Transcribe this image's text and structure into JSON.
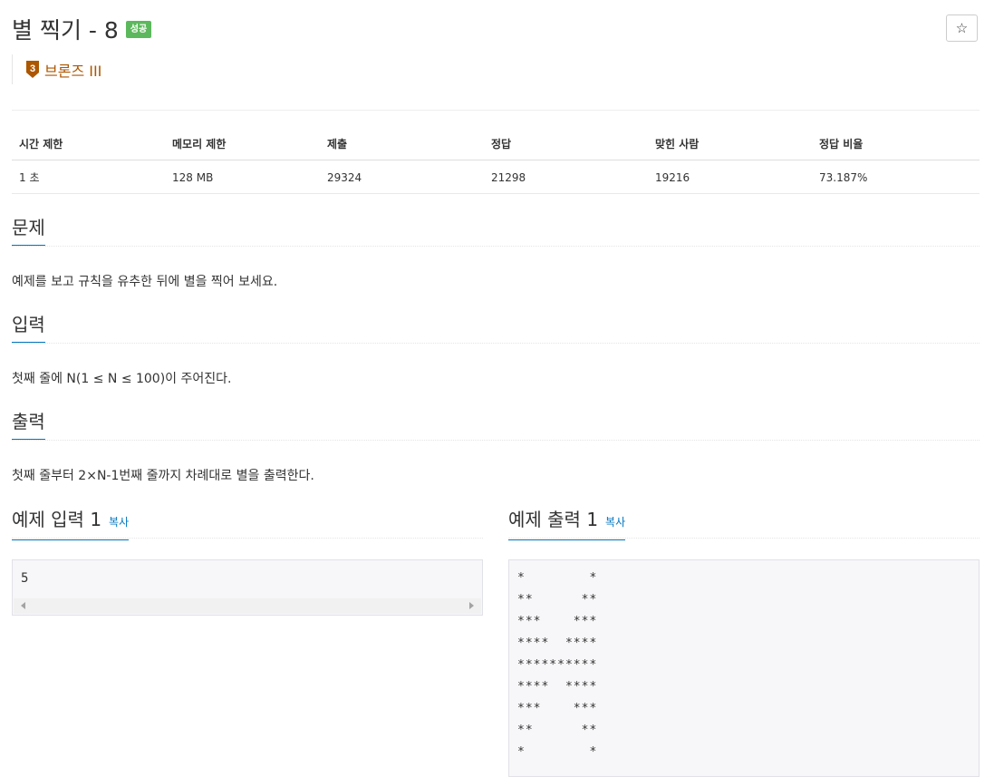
{
  "problem": {
    "title": "별 찍기 - 8",
    "status_badge": "성공",
    "tier": {
      "number": "3",
      "label": "브론즈 III",
      "color": "#ad5600"
    },
    "star_button_icon": "☆"
  },
  "info_table": {
    "headers": [
      "시간 제한",
      "메모리 제한",
      "제출",
      "정답",
      "맞힌 사람",
      "정답 비율"
    ],
    "values": [
      "1 초",
      "128 MB",
      "29324",
      "21298",
      "19216",
      "73.187%"
    ]
  },
  "sections": {
    "description": {
      "title": "문제",
      "text": "예제를 보고 규칙을 유추한 뒤에 별을 찍어 보세요."
    },
    "input": {
      "title": "입력",
      "text": "첫째 줄에 N(1 ≤ N ≤ 100)이 주어진다."
    },
    "output": {
      "title": "출력",
      "text": "첫째 줄부터 2×N-1번째 줄까지 차례대로 별을 출력한다."
    }
  },
  "samples": {
    "input_title": "예제 입력 1",
    "output_title": "예제 출력 1",
    "copy_label": "복사",
    "input_text": "5",
    "output_lines": [
      "*        *",
      "**      **",
      "***    ***",
      "****  ****",
      "**********",
      "****  ****",
      "***    ***",
      "**      **",
      "*        *"
    ]
  },
  "colors": {
    "success": "#5cb85c",
    "accent": "#0076c0",
    "tier_bronze": "#ad5600"
  }
}
